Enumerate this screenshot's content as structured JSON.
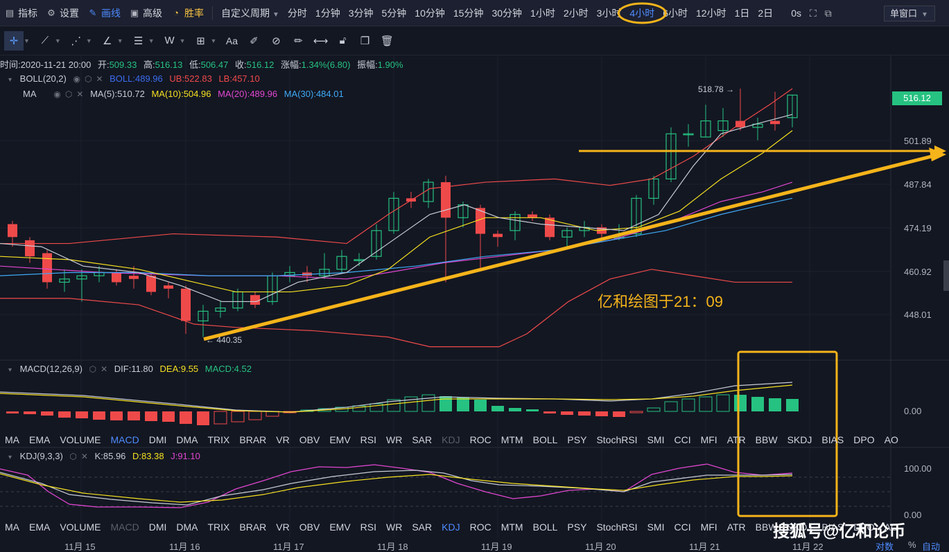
{
  "toolbar": {
    "indicators": "指标",
    "settings": "设置",
    "draw": "画线",
    "advanced": "高级",
    "winrate": "胜率",
    "custom_period": "自定义周期",
    "periods": [
      "分时",
      "1分钟",
      "3分钟",
      "5分钟",
      "10分钟",
      "15分钟",
      "30分钟",
      "1小时",
      "2小时",
      "3小时",
      "4小时",
      "6小时",
      "12小时",
      "1日",
      "2日"
    ],
    "active_period": "4小时",
    "countdown": "0s",
    "window_mode": "单窗口"
  },
  "candle_info": {
    "time_label": "时间:",
    "time": "2020-11-21 20:00",
    "open_label": "开:",
    "open": "509.33",
    "high_label": "高:",
    "high": "516.13",
    "low_label": "低:",
    "low": "506.47",
    "close_label": "收:",
    "close": "516.12",
    "change_label": "涨幅:",
    "change": "1.34%(6.80)",
    "amplitude_label": "振幅:",
    "amplitude": "1.90%"
  },
  "boll": {
    "name": "BOLL(20,2)",
    "boll": "BOLL:489.96",
    "ub": "UB:522.83",
    "lb": "LB:457.10"
  },
  "ma": {
    "name": "MA",
    "ma5": "MA(5):510.72",
    "ma10": "MA(10):504.96",
    "ma20": "MA(20):489.96",
    "ma30": "MA(30):484.01"
  },
  "macd": {
    "name": "MACD(12,26,9)",
    "dif": "DIF:11.80",
    "dea": "DEA:9.55",
    "macd": "MACD:4.52"
  },
  "kdj": {
    "name": "KDJ(9,3,3)",
    "k": "K:85.96",
    "d": "D:83.38",
    "j": "J:91.10"
  },
  "price_axis": [
    "501.89",
    "487.84",
    "474.19",
    "460.92",
    "448.01"
  ],
  "last_price": "516.12",
  "macd_axis": "0.00",
  "kdj_axis": [
    "100.00",
    "0.00"
  ],
  "high_marker": "518.78",
  "low_marker": "440.35",
  "annotation": "亿和绘图于21：09",
  "indicator_tabs": [
    "MA",
    "EMA",
    "VOLUME",
    "MACD",
    "DMI",
    "DMA",
    "TRIX",
    "BRAR",
    "VR",
    "OBV",
    "EMV",
    "RSI",
    "WR",
    "SAR",
    "KDJ",
    "ROC",
    "MTM",
    "BOLL",
    "PSY",
    "StochRSI",
    "SMI",
    "CCI",
    "MFI",
    "ATR",
    "BBW",
    "SKDJ",
    "BIAS",
    "DPO",
    "AO"
  ],
  "tabs_row1_active": "MACD",
  "tabs_row1_disabled": "KDJ",
  "tabs_row2_active": "KDJ",
  "tabs_row2_disabled": "MACD",
  "dates": [
    "11月 15",
    "11月 16",
    "11月 17",
    "11月 18",
    "11月 19",
    "11月 20",
    "11月 21",
    "11月 22"
  ],
  "watermark": "搜狐号@亿和论币",
  "scale_log": "对数",
  "scale_pct": "%",
  "scale_auto": "自动",
  "colors": {
    "up": "#26c281",
    "down": "#ef4a4a",
    "accent": "#4e8bff",
    "annotation": "#f5b41a"
  }
}
